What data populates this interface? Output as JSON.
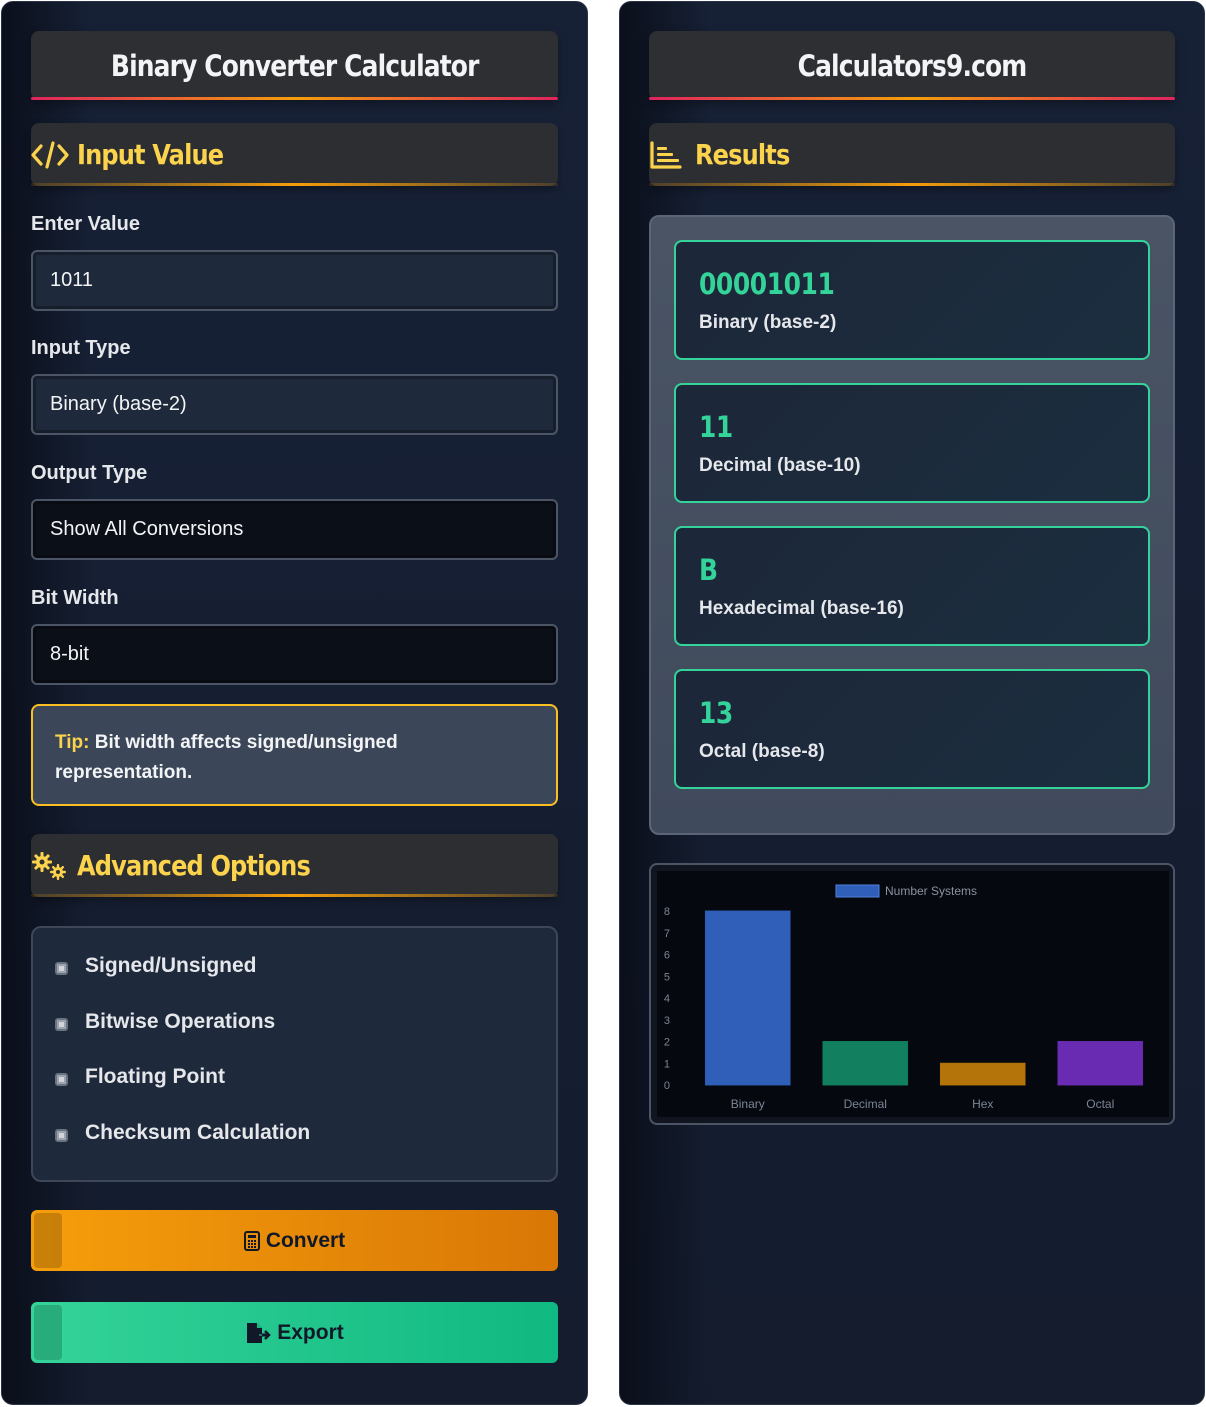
{
  "left_panel": {
    "title": "Binary Converter Calculator",
    "input_section": {
      "title": "Input Value",
      "icon": "code-icon"
    },
    "fields": {
      "enter_value": {
        "label": "Enter Value",
        "value": "1011"
      },
      "input_type": {
        "label": "Input Type",
        "value": "Binary (base-2)"
      },
      "output_type": {
        "label": "Output Type",
        "value": "Show All Conversions"
      },
      "bit_width": {
        "label": "Bit Width",
        "value": "8-bit"
      }
    },
    "tip": {
      "label": "Tip:",
      "text": " Bit width affects signed/unsigned representation."
    },
    "advanced_section": {
      "title": "Advanced Options",
      "icon": "gears-icon"
    },
    "options": [
      {
        "label": "Signed/Unsigned"
      },
      {
        "label": "Bitwise Operations"
      },
      {
        "label": "Floating Point"
      },
      {
        "label": "Checksum Calculation"
      }
    ],
    "buttons": {
      "convert": {
        "label": "Convert",
        "icon": "calculator-icon"
      },
      "export": {
        "label": "Export",
        "icon": "file-export-icon"
      }
    }
  },
  "right_panel": {
    "title": "Calculators9.com",
    "results_section": {
      "title": "Results",
      "icon": "chart-bars-icon"
    },
    "results": [
      {
        "value": "00001011",
        "label": "Binary (base-2)"
      },
      {
        "value": "11",
        "label": "Decimal (base-10)"
      },
      {
        "value": "B",
        "label": "Hexadecimal (base-16)"
      },
      {
        "value": "13",
        "label": "Octal (base-8)"
      }
    ]
  },
  "colors": {
    "accent_gold": "#fcd34d",
    "accent_green": "#34d399",
    "convert_button": "#f59e0b",
    "export_button": "#10b981"
  },
  "chart_data": {
    "type": "bar",
    "categories": [
      "Binary",
      "Decimal",
      "Hex",
      "Octal"
    ],
    "series": [
      {
        "name": "Number Systems",
        "values": [
          8,
          2,
          1,
          2
        ]
      }
    ],
    "bar_colors": [
      "#2f5fb8",
      "#12805e",
      "#b4740a",
      "#6a2bb3"
    ],
    "ylim": [
      0,
      8
    ],
    "yticks": [
      "0",
      "1",
      "2",
      "3",
      "4",
      "5",
      "6",
      "7",
      "8"
    ],
    "legend_position": "top"
  }
}
